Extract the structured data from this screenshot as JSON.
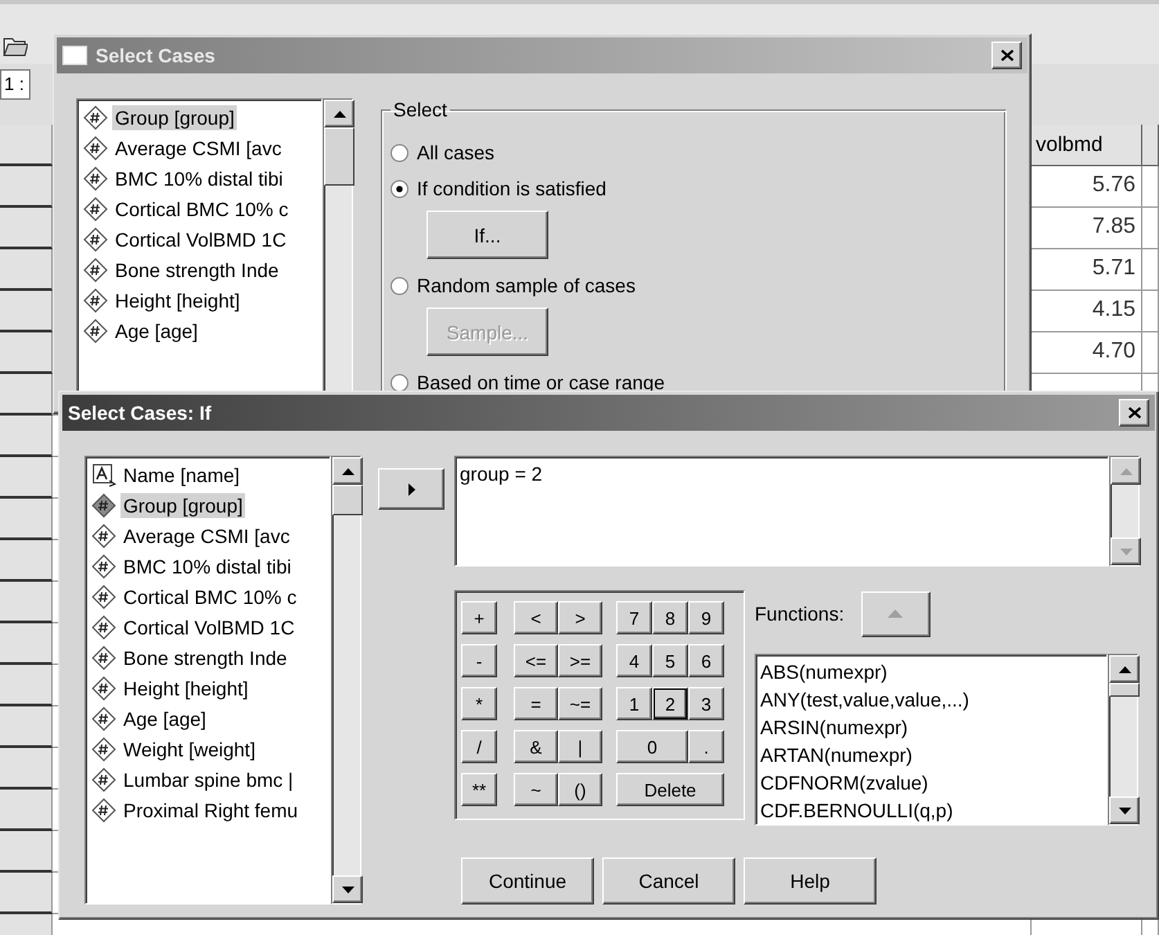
{
  "data_editor": {
    "cell_ref": "1 :",
    "grid": {
      "columns": [
        "volbmd"
      ],
      "rows": [
        [
          "5.76"
        ],
        [
          "7.85"
        ],
        [
          "5.71"
        ],
        [
          "4.15"
        ],
        [
          "4.70"
        ]
      ]
    }
  },
  "select_cases": {
    "title": "Select Cases",
    "active": false,
    "variables": [
      {
        "label": "Group [group]",
        "kind": "numeric",
        "selected": true
      },
      {
        "label": "Average CSMI [avc",
        "kind": "numeric",
        "selected": false
      },
      {
        "label": "BMC 10% distal tibi",
        "kind": "numeric",
        "selected": false
      },
      {
        "label": "Cortical BMC 10% c",
        "kind": "numeric",
        "selected": false
      },
      {
        "label": "Cortical VolBMD 1C",
        "kind": "numeric",
        "selected": false
      },
      {
        "label": "Bone strength Inde",
        "kind": "numeric",
        "selected": false
      },
      {
        "label": "Height [height]",
        "kind": "numeric",
        "selected": false
      },
      {
        "label": "Age [age]",
        "kind": "numeric",
        "selected": false
      }
    ],
    "select_group": {
      "label": "Select",
      "options": [
        {
          "label": "All cases",
          "selected": false
        },
        {
          "label": "If condition is satisfied",
          "selected": true,
          "button": {
            "label": "If...",
            "disabled": false
          }
        },
        {
          "label": "Random sample of cases",
          "selected": false,
          "button": {
            "label": "Sample...",
            "disabled": true
          }
        },
        {
          "label": "Based on time or case range",
          "selected": false
        }
      ]
    }
  },
  "if_dialog": {
    "title": "Select Cases: If",
    "active": true,
    "variables": [
      {
        "label": "Name [name]",
        "kind": "string",
        "selected": false
      },
      {
        "label": "Group [group]",
        "kind": "numeric",
        "selected": true
      },
      {
        "label": "Average CSMI [avc",
        "kind": "numeric",
        "selected": false
      },
      {
        "label": "BMC 10% distal tibi",
        "kind": "numeric",
        "selected": false
      },
      {
        "label": "Cortical BMC 10% c",
        "kind": "numeric",
        "selected": false
      },
      {
        "label": "Cortical VolBMD 1C",
        "kind": "numeric",
        "selected": false
      },
      {
        "label": "Bone strength Inde",
        "kind": "numeric",
        "selected": false
      },
      {
        "label": "Height [height]",
        "kind": "numeric",
        "selected": false
      },
      {
        "label": "Age [age]",
        "kind": "numeric",
        "selected": false
      },
      {
        "label": "Weight [weight]",
        "kind": "numeric",
        "selected": false
      },
      {
        "label": "Lumbar spine bmc |",
        "kind": "numeric",
        "selected": false
      },
      {
        "label": "Proximal Right femu",
        "kind": "numeric",
        "selected": false
      }
    ],
    "expression": "group = 2",
    "keypad": [
      [
        {
          "label": "+",
          "focused": false
        },
        {
          "label": "<",
          "focused": false
        },
        {
          "label": ">",
          "focused": false
        },
        {
          "label": "7",
          "focused": false
        },
        {
          "label": "8",
          "focused": false
        },
        {
          "label": "9",
          "focused": false
        }
      ],
      [
        {
          "label": "-",
          "focused": false
        },
        {
          "label": "<=",
          "focused": false
        },
        {
          "label": ">=",
          "focused": false
        },
        {
          "label": "4",
          "focused": false
        },
        {
          "label": "5",
          "focused": false
        },
        {
          "label": "6",
          "focused": false
        }
      ],
      [
        {
          "label": "*",
          "focused": false
        },
        {
          "label": "=",
          "focused": false
        },
        {
          "label": "~=",
          "focused": false
        },
        {
          "label": "1",
          "focused": false
        },
        {
          "label": "2",
          "focused": true
        },
        {
          "label": "3",
          "focused": false
        }
      ],
      [
        {
          "label": "/",
          "focused": false
        },
        {
          "label": "&",
          "focused": false
        },
        {
          "label": "|",
          "focused": false
        },
        {
          "label": "0",
          "focused": false
        },
        {
          "label": ".",
          "focused": false
        }
      ],
      [
        {
          "label": "**",
          "focused": false
        },
        {
          "label": "~",
          "focused": false
        },
        {
          "label": "()",
          "focused": false
        },
        {
          "label": "Delete",
          "focused": false
        }
      ]
    ],
    "functions_label": "Functions:",
    "functions": [
      "ABS(numexpr)",
      "ANY(test,value,value,...)",
      "ARSIN(numexpr)",
      "ARTAN(numexpr)",
      "CDFNORM(zvalue)",
      "CDF.BERNOULLI(q,p)"
    ],
    "buttons": [
      "Continue",
      "Cancel",
      "Help"
    ]
  }
}
